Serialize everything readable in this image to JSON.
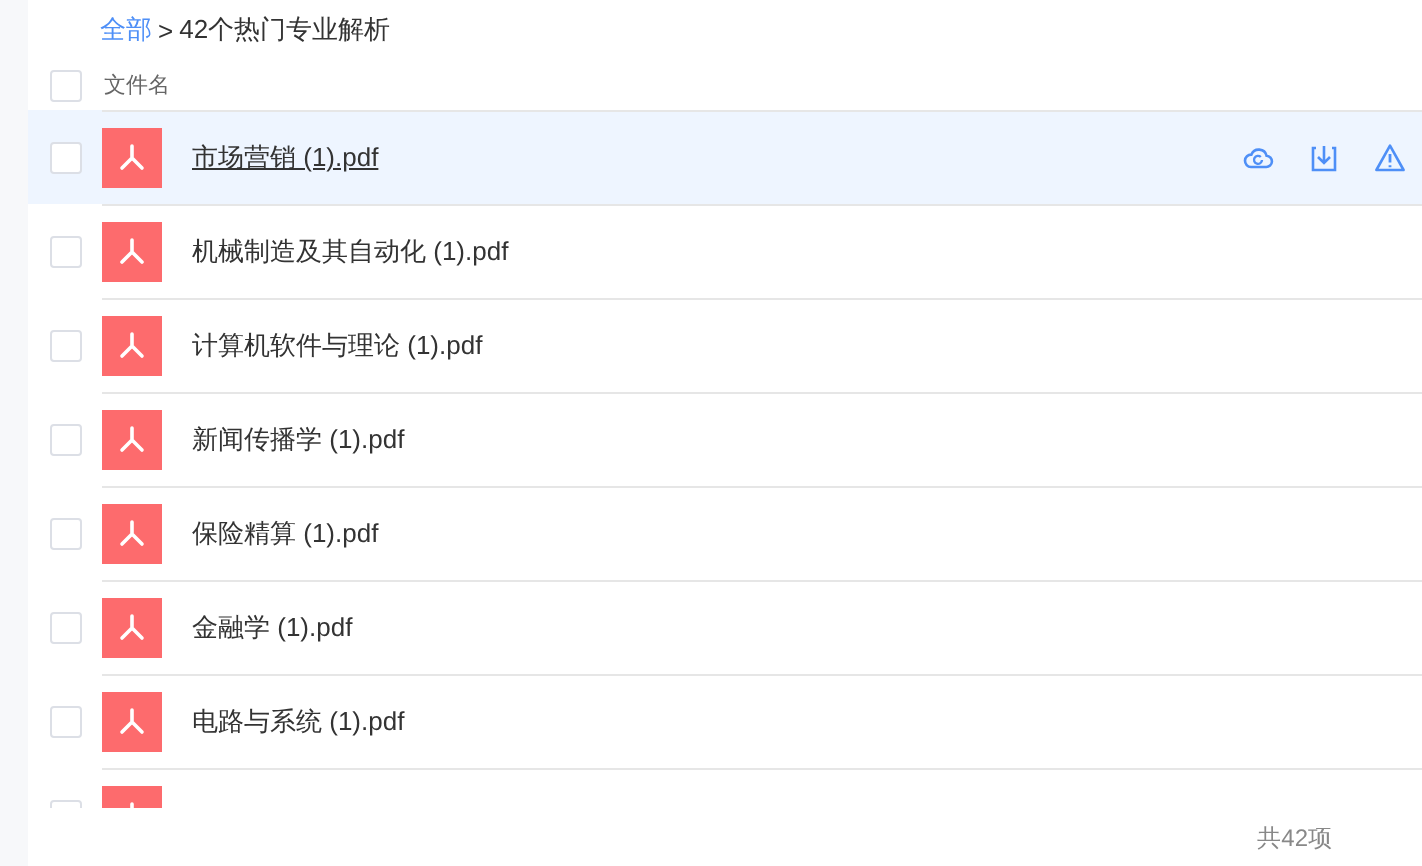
{
  "breadcrumb": {
    "root": "全部",
    "separator": ">",
    "current": "42个热门专业解析"
  },
  "header": {
    "checked": false,
    "column": "文件名"
  },
  "files": [
    {
      "name": "市场营销 (1).pdf",
      "selected": true,
      "checked": false
    },
    {
      "name": "机械制造及其自动化 (1).pdf",
      "selected": false,
      "checked": false
    },
    {
      "name": "计算机软件与理论 (1).pdf",
      "selected": false,
      "checked": false
    },
    {
      "name": "新闻传播学 (1).pdf",
      "selected": false,
      "checked": false
    },
    {
      "name": "保险精算 (1).pdf",
      "selected": false,
      "checked": false
    },
    {
      "name": "金融学 (1).pdf",
      "selected": false,
      "checked": false
    },
    {
      "name": "电路与系统 (1).pdf",
      "selected": false,
      "checked": false
    },
    {
      "selected": false,
      "checked": false
    }
  ],
  "footer": {
    "count": "共42项"
  }
}
